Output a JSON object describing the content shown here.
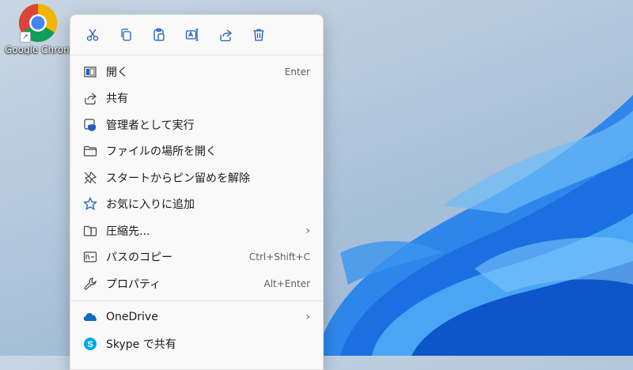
{
  "desktop": {
    "icon_label": "Google Chrom",
    "wallpaper_colors": {
      "bloom": "#1f7ae8",
      "light": "#5ab2f7",
      "dark": "#0b4fc3"
    }
  },
  "quick_actions": [
    {
      "name": "cut-icon"
    },
    {
      "name": "copy-icon"
    },
    {
      "name": "paste-icon"
    },
    {
      "name": "rename-icon"
    },
    {
      "name": "share-icon"
    },
    {
      "name": "delete-icon"
    }
  ],
  "menu_items": [
    {
      "label": "開く",
      "shortcut": "Enter",
      "icon": "open-window-icon"
    },
    {
      "label": "共有",
      "shortcut": "",
      "icon": "share-icon"
    },
    {
      "label": "管理者として実行",
      "shortcut": "",
      "icon": "admin-shield-icon"
    },
    {
      "label": "ファイルの場所を開く",
      "shortcut": "",
      "icon": "folder-icon"
    },
    {
      "label": "スタートからピン留めを解除",
      "shortcut": "",
      "icon": "unpin-icon"
    },
    {
      "label": "お気に入りに追加",
      "shortcut": "",
      "icon": "star-icon"
    },
    {
      "label": "圧縮先...",
      "shortcut": "",
      "icon": "zip-folder-icon",
      "submenu": true
    },
    {
      "label": "パスのコピー",
      "shortcut": "Ctrl+Shift+C",
      "icon": "copy-path-icon"
    },
    {
      "label": "プロパティ",
      "shortcut": "Alt+Enter",
      "icon": "wrench-icon"
    }
  ],
  "extra_items": [
    {
      "label": "OneDrive",
      "icon": "onedrive-icon",
      "submenu": true
    },
    {
      "label": "Skype で共有",
      "icon": "skype-icon"
    }
  ],
  "chevron": "›"
}
